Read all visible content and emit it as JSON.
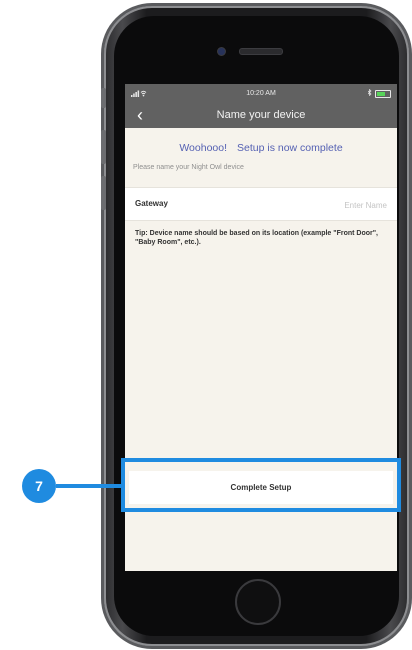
{
  "status_bar": {
    "time": "10:20 AM"
  },
  "header": {
    "back_icon": "chevron-left-icon",
    "title": "Name your device"
  },
  "success_message": {
    "part1": "Woohooo!",
    "part2": "Setup is now complete"
  },
  "prompt": "Please name your Night Owl device",
  "device_field": {
    "label": "Gateway",
    "value": "",
    "placeholder": "Enter Name"
  },
  "tip": "Tip: Device name should be based on its location (example \"Front Door\", \"Baby Room\", etc.).",
  "complete_button": {
    "label": "Complete Setup"
  },
  "callout": {
    "number": "7"
  },
  "colors": {
    "accent_blue": "#1f8be0",
    "success_text": "#5561b3",
    "header_bar": "#616161",
    "screen_background": "#f6f3ec"
  }
}
